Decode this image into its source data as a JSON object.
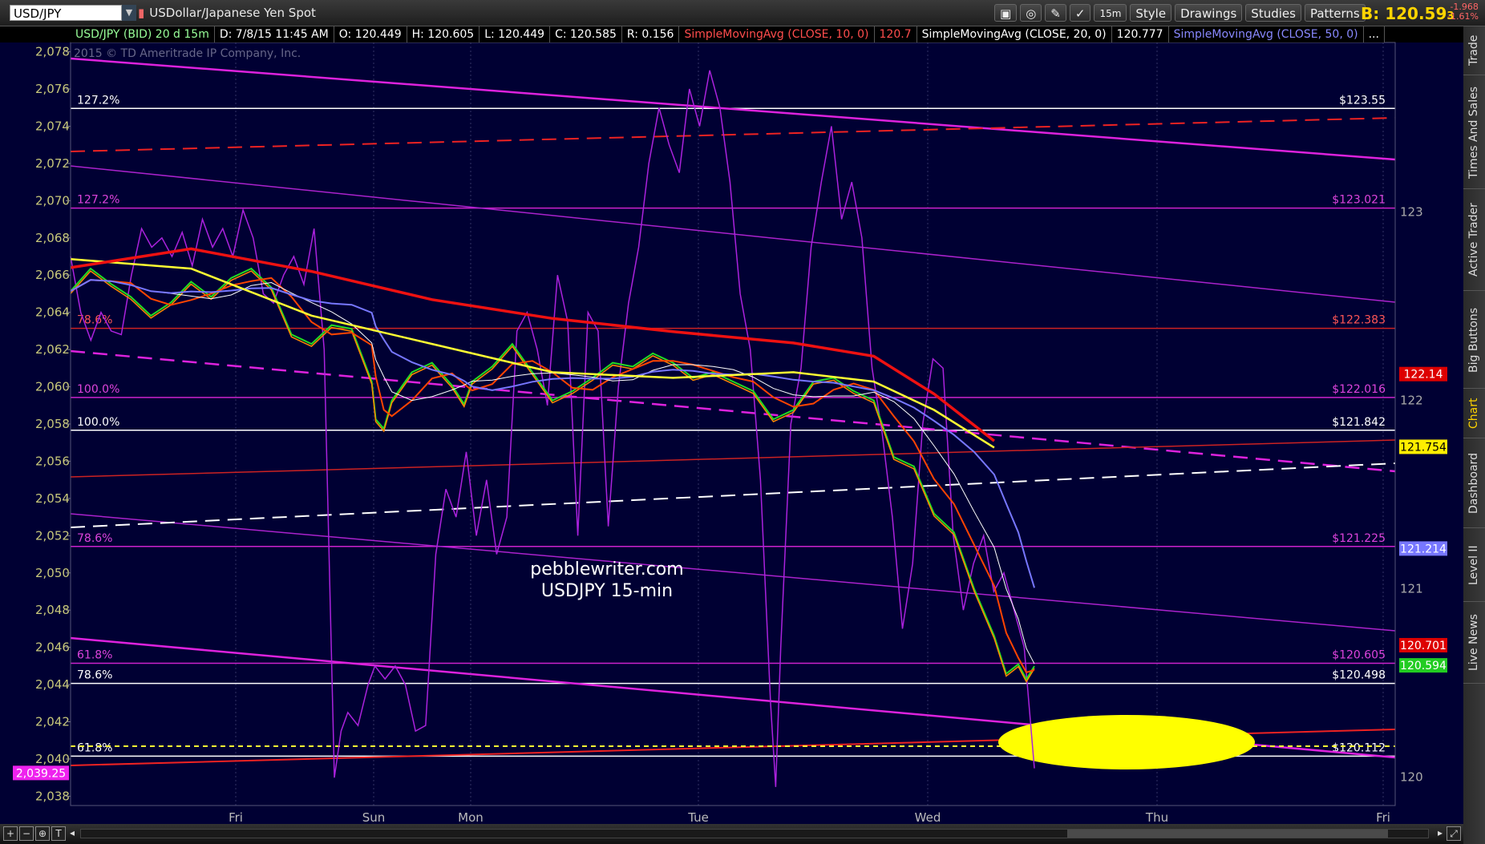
{
  "topbar": {
    "symbol": "USD/JPY",
    "description": "USDollar/Japanese Yen Spot",
    "timeframe_btn": "15m",
    "style_btn": "Style",
    "drawings_btn": "Drawings",
    "studies_btn": "Studies",
    "patterns_btn": "Patterns",
    "bid_label": "B: 120.59",
    "bid_small": "3",
    "change_abs": "-1.968",
    "change_pct": "-1.61%"
  },
  "infobar": {
    "symbol": "USD/JPY (BID) 20 d 15m",
    "date": "D: 7/8/15 11:45 AM",
    "open": "O: 120.449",
    "high": "H: 120.605",
    "low": "L: 120.449",
    "close": "C: 120.585",
    "range": "R: 0.156",
    "sma10": "SimpleMovingAvg (CLOSE, 10, 0)",
    "sma10_val": "120.7",
    "sma20": "SimpleMovingAvg (CLOSE, 20, 0)",
    "sma20_val": "120.777",
    "sma50": "SimpleMovingAvg (CLOSE, 50, 0)",
    "more": "..."
  },
  "sidebar": {
    "tabs": [
      "Trade",
      "Times And Sales",
      "Active Trader",
      "Big Buttons",
      "Chart",
      "Dashboard",
      "Level II",
      "Live News"
    ],
    "active": "Chart"
  },
  "copyright": "2015 © TD Ameritrade IP Company, Inc.",
  "watermark": [
    "pebblewriter.com",
    "USDJPY 15-min"
  ],
  "colors": {
    "background": "#000033",
    "price_green": "#3cff3c",
    "price_red": "#ff3300",
    "sma10": "#ff4400",
    "sma20": "#ffffff",
    "sma50": "#7777ff",
    "sma_yellow": "#ffff33",
    "sma_red": "#ee1111",
    "spx_overlay": "#aa22dd",
    "channel_magenta": "#dd22dd",
    "fib_line": "#ffffff",
    "target_ellipse": "#ffff00"
  },
  "chart_data": {
    "type": "line",
    "title": "USD/JPY (BID) 20 d 15m",
    "x_labels": [
      "Fri",
      "Sun",
      "Mon",
      "Tue",
      "Wed",
      "Thu",
      "Fri"
    ],
    "left_axis": {
      "ticks": [
        "2,078",
        "2,076",
        "2,074",
        "2,072",
        "2,070",
        "2,068",
        "2,066",
        "2,064",
        "2,062",
        "2,060",
        "2,058",
        "2,056",
        "2,054",
        "2,052",
        "2,050",
        "2,048",
        "2,046",
        "2,044",
        "2,042",
        "2,040",
        "2,038"
      ],
      "ylim": [
        2037.5,
        2078.5
      ],
      "last_value_badge": "2,039.25"
    },
    "right_axis": {
      "ticks": [
        "123",
        "122",
        "121",
        "120"
      ],
      "ylim": [
        119.85,
        123.9
      ]
    },
    "price_badges": [
      {
        "label": "122.14",
        "value": 122.14,
        "color": "#dd0000"
      },
      {
        "label": "121.754",
        "value": 121.754,
        "color": "#ffee00"
      },
      {
        "label": "121.214",
        "value": 121.214,
        "color": "#7777ff"
      },
      {
        "label": "120.701",
        "value": 120.701,
        "color": "#dd0000"
      },
      {
        "label": "120.594",
        "value": 120.594,
        "color": "#22cc22"
      }
    ],
    "fib_levels_white": [
      {
        "pct": "127.2%",
        "price": "$123.55",
        "value": 123.55
      },
      {
        "pct": "100.0%",
        "price": "$121.842",
        "value": 121.842
      },
      {
        "pct": "78.6%",
        "price": "$120.498",
        "value": 120.498
      },
      {
        "pct": "61.8%",
        "price": "$120.112",
        "value": 120.112
      }
    ],
    "fib_levels_magenta": [
      {
        "pct": "127.2%",
        "price": "$123.021",
        "value": 123.021
      },
      {
        "pct": "100.0%",
        "price": "$122.016",
        "value": 122.016
      },
      {
        "pct": "78.6%",
        "price": "$121.225",
        "value": 121.225
      },
      {
        "pct": "61.8%",
        "price": "$120.605",
        "value": 120.605
      }
    ],
    "fib_levels_red": [
      {
        "pct": "78.6%",
        "price": "$122.383",
        "value": 122.383
      }
    ],
    "series": [
      {
        "name": "SimpleMovingAvg (CLOSE, 10, 0)"
      },
      {
        "name": "SimpleMovingAvg (CLOSE, 20, 0)"
      },
      {
        "name": "SimpleMovingAvg (CLOSE, 50, 0)"
      }
    ],
    "price_path": [
      [
        0.0,
        122.58
      ],
      [
        0.5,
        122.7
      ],
      [
        1,
        122.62
      ],
      [
        1.5,
        122.55
      ],
      [
        2,
        122.45
      ],
      [
        2.5,
        122.52
      ],
      [
        3,
        122.63
      ],
      [
        3.5,
        122.55
      ],
      [
        4,
        122.65
      ],
      [
        4.5,
        122.7
      ],
      [
        5,
        122.6
      ],
      [
        5.5,
        122.35
      ],
      [
        6,
        122.3
      ],
      [
        6.5,
        122.4
      ],
      [
        7,
        122.38
      ],
      [
        7.5,
        122.1
      ],
      [
        7.6,
        121.9
      ],
      [
        7.8,
        121.85
      ],
      [
        8,
        122.0
      ],
      [
        8.5,
        122.15
      ],
      [
        9,
        122.2
      ],
      [
        9.5,
        122.08
      ],
      [
        9.8,
        121.98
      ],
      [
        10,
        122.1
      ],
      [
        10.5,
        122.18
      ],
      [
        11,
        122.3
      ],
      [
        11.5,
        122.15
      ],
      [
        12,
        122.0
      ],
      [
        12.5,
        122.05
      ],
      [
        13,
        122.12
      ],
      [
        13.5,
        122.2
      ],
      [
        14,
        122.18
      ],
      [
        14.5,
        122.25
      ],
      [
        15,
        122.2
      ],
      [
        15.5,
        122.12
      ],
      [
        16,
        122.15
      ],
      [
        16.5,
        122.1
      ],
      [
        17,
        122.05
      ],
      [
        17.5,
        121.9
      ],
      [
        18,
        121.95
      ],
      [
        18.5,
        122.1
      ],
      [
        19,
        122.12
      ],
      [
        19.5,
        122.05
      ],
      [
        20,
        122.0
      ],
      [
        20.5,
        121.7
      ],
      [
        21,
        121.65
      ],
      [
        21.5,
        121.4
      ],
      [
        22,
        121.3
      ],
      [
        22.5,
        121.0
      ],
      [
        23,
        120.75
      ],
      [
        23.3,
        120.55
      ],
      [
        23.6,
        120.6
      ],
      [
        23.8,
        120.52
      ],
      [
        24,
        120.59
      ]
    ],
    "overlay_path_desc": "secondary (purple) instrument on left axis",
    "target_zone": {
      "center_price": 120.12
    }
  }
}
